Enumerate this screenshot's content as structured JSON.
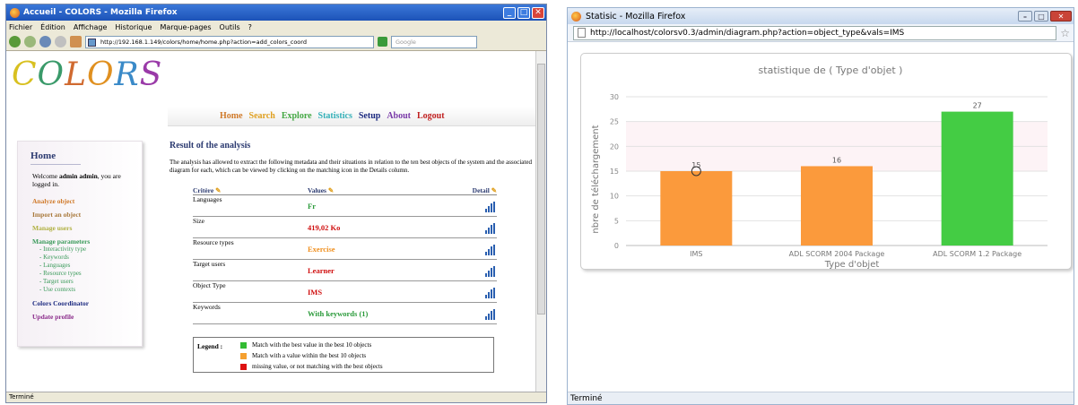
{
  "win1": {
    "title": "Accueil - COLORS - Mozilla Firefox",
    "menu": [
      "Fichier",
      "Édition",
      "Affichage",
      "Historique",
      "Marque-pages",
      "Outils",
      "?"
    ],
    "url": "http://192.168.1.149/colors/home/home.php?action=add_colors_coord",
    "search_placeholder": "Google",
    "status": "Terminé",
    "logo": "COLORS",
    "nav": [
      "Home",
      "Search",
      "Explore",
      "Statistics",
      "Setup",
      "About",
      "Logout"
    ],
    "nav_colors": [
      "#d07a2a",
      "#e0a020",
      "#44a844",
      "#34b0b8",
      "#1c2a80",
      "#7a3aa8",
      "#c02020"
    ],
    "sidebar": {
      "title": "Home",
      "welcome_prefix": "Welcome ",
      "welcome_user": "admin admin",
      "welcome_suffix": ", you are logged in.",
      "items": [
        {
          "label": "Analyze object",
          "color": "#d07a2a"
        },
        {
          "label": "Import an object",
          "color": "#a8783a"
        },
        {
          "label": "Manage users",
          "color": "#b0b040"
        },
        {
          "label": "Manage parameters",
          "color": "#3a9a5a"
        }
      ],
      "subitems": [
        "- Interactivity type",
        "- Keywords",
        "- Languages",
        "- Resource types",
        "- Target users",
        "- Use contexts"
      ],
      "subitem_color": "#3a9a5a",
      "bottom_items": [
        {
          "label": "Colors Coordinator",
          "color": "#1c2a80"
        },
        {
          "label": "Update profile",
          "color": "#8a2a8a"
        }
      ]
    },
    "main": {
      "title": "Result of the analysis",
      "intro": "The analysis has allowed to extract the following metadata and their situations in relation to the ten best objects of the system and the associated diagram for each, which can be viewed by clicking on the matching icon in the Details column.",
      "headers": [
        "Critère",
        "Values",
        "Detail"
      ],
      "rows": [
        {
          "criterion": "Languages",
          "value": "Fr",
          "color": "#2a9a3a"
        },
        {
          "criterion": "Size",
          "value": "419,02 Ko",
          "color": "#d01010"
        },
        {
          "criterion": "Resource types",
          "value": "Exercise",
          "color": "#f09020"
        },
        {
          "criterion": "Target users",
          "value": "Learner",
          "color": "#d01010"
        },
        {
          "criterion": "Object Type",
          "value": "IMS",
          "color": "#d01010"
        },
        {
          "criterion": "Keywords",
          "value": "With keywords (1)",
          "color": "#2a9a3a"
        }
      ],
      "legend_title": "Legend :",
      "legend": [
        {
          "label": "Match with the best value in the best 10 objects",
          "color": "#33bb33"
        },
        {
          "label": "Match with a value within the best 10 objects",
          "color": "#f5a030"
        },
        {
          "label": "missing value, or not matching with the best objects",
          "color": "#dd1111"
        }
      ]
    }
  },
  "win2": {
    "title": "Statisic - Mozilla Firefox",
    "url": "http://localhost/colorsv0.3/admin/diagram.php?action=object_type&vals=IMS",
    "status": "Terminé"
  },
  "chart_data": {
    "type": "bar",
    "title": "statistique de ( Type d'objet )",
    "xlabel": "Type d'objet",
    "ylabel": "nbre de téléchargement",
    "categories": [
      "IMS",
      "ADL SCORM 2004 Package",
      "ADL SCORM 1.2 Package"
    ],
    "values": [
      15,
      16,
      27
    ],
    "colors": [
      "#fb9a3c",
      "#fb9a3c",
      "#44cc44"
    ],
    "ylim": [
      0,
      30
    ],
    "yticks": [
      0,
      5,
      10,
      15,
      20,
      25,
      30
    ],
    "grid": true
  }
}
